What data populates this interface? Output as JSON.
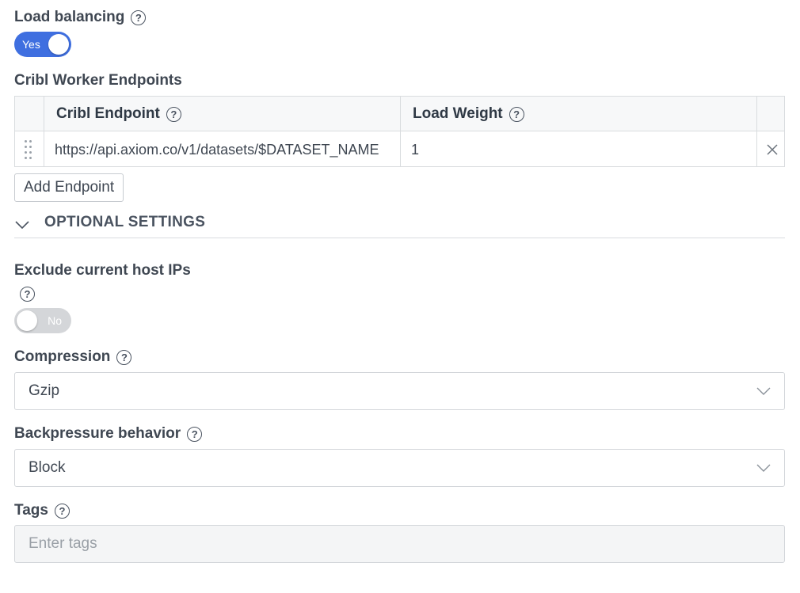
{
  "load_balancing": {
    "label": "Load balancing",
    "toggle_text": "Yes"
  },
  "endpoints": {
    "label": "Cribl Worker Endpoints",
    "columns": [
      "Cribl Endpoint",
      "Load Weight"
    ],
    "rows": [
      {
        "endpoint": "https://api.axiom.co/v1/datasets/$DATASET_NAME",
        "weight": "1"
      }
    ],
    "add_button": "Add Endpoint"
  },
  "optional_settings": {
    "title": "OPTIONAL SETTINGS"
  },
  "exclude_hosts": {
    "label": "Exclude current host IPs",
    "toggle_text": "No"
  },
  "compression": {
    "label": "Compression",
    "value": "Gzip"
  },
  "backpressure": {
    "label": "Backpressure behavior",
    "value": "Block"
  },
  "tags": {
    "label": "Tags",
    "placeholder": "Enter tags"
  },
  "colors": {
    "accent": "#3f6fe0",
    "toggle_off": "#d4d6d9",
    "text": "#3f4752"
  }
}
